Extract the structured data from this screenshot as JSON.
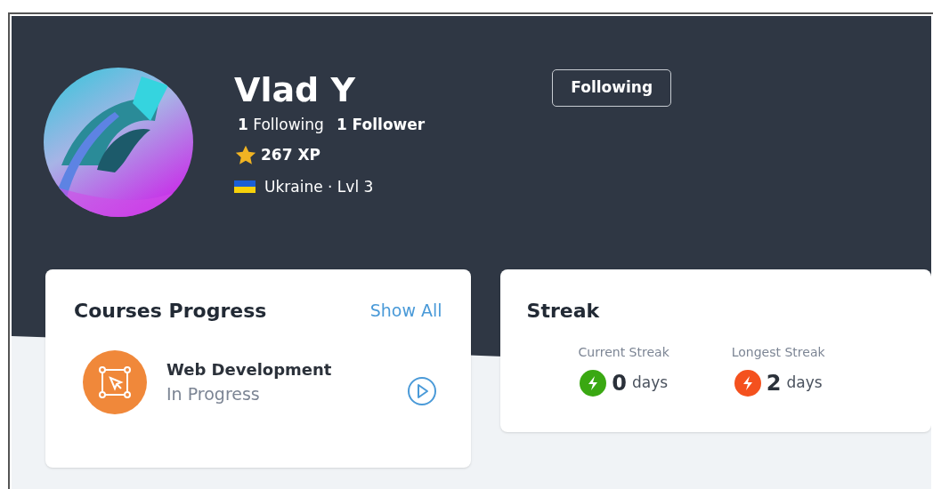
{
  "profile": {
    "name": "Vlad Y",
    "following_count": "1",
    "following_label": "Following",
    "followers_count": "1",
    "followers_label": "Follower",
    "xp": "267 XP",
    "location": "Ukraine · Lvl 3"
  },
  "follow_button": {
    "label": "Following"
  },
  "courses": {
    "title": "Courses Progress",
    "link": "Show All",
    "items": [
      {
        "title": "Web Development",
        "status": "In Progress"
      }
    ]
  },
  "streak": {
    "title": "Streak",
    "items": [
      {
        "label": "Current Streak",
        "value": "0",
        "unit": "days",
        "color": "#3aa812"
      },
      {
        "label": "Longest Streak",
        "value": "2",
        "unit": "days",
        "color": "#f4511e"
      }
    ]
  }
}
